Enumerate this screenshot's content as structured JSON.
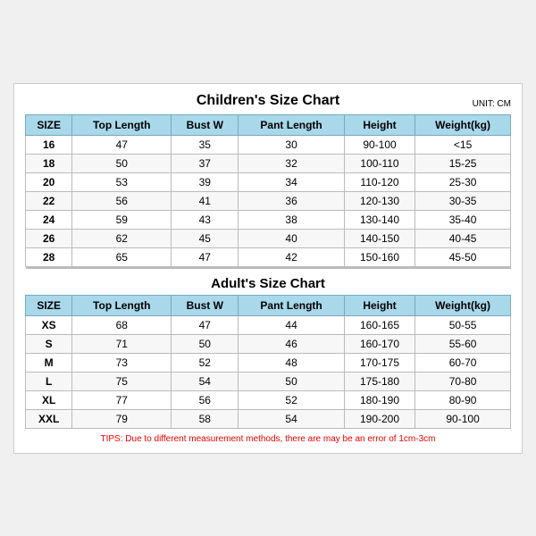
{
  "title": "Children's Size Chart",
  "unit": "UNIT: CM",
  "children_headers": [
    "SIZE",
    "Top Length",
    "Bust W",
    "Pant Length",
    "Height",
    "Weight(kg)"
  ],
  "children_rows": [
    [
      "16",
      "47",
      "35",
      "30",
      "90-100",
      "<15"
    ],
    [
      "18",
      "50",
      "37",
      "32",
      "100-110",
      "15-25"
    ],
    [
      "20",
      "53",
      "39",
      "34",
      "110-120",
      "25-30"
    ],
    [
      "22",
      "56",
      "41",
      "36",
      "120-130",
      "30-35"
    ],
    [
      "24",
      "59",
      "43",
      "38",
      "130-140",
      "35-40"
    ],
    [
      "26",
      "62",
      "45",
      "40",
      "140-150",
      "40-45"
    ],
    [
      "28",
      "65",
      "47",
      "42",
      "150-160",
      "45-50"
    ]
  ],
  "adults_title": "Adult's Size Chart",
  "adults_headers": [
    "SIZE",
    "Top Length",
    "Bust W",
    "Pant Length",
    "Height",
    "Weight(kg)"
  ],
  "adults_rows": [
    [
      "XS",
      "68",
      "47",
      "44",
      "160-165",
      "50-55"
    ],
    [
      "S",
      "71",
      "50",
      "46",
      "160-170",
      "55-60"
    ],
    [
      "M",
      "73",
      "52",
      "48",
      "170-175",
      "60-70"
    ],
    [
      "L",
      "75",
      "54",
      "50",
      "175-180",
      "70-80"
    ],
    [
      "XL",
      "77",
      "56",
      "52",
      "180-190",
      "80-90"
    ],
    [
      "XXL",
      "79",
      "58",
      "54",
      "190-200",
      "90-100"
    ]
  ],
  "tips": "TIPS: Due to different measurement methods, there are may be an error of 1cm-3cm"
}
